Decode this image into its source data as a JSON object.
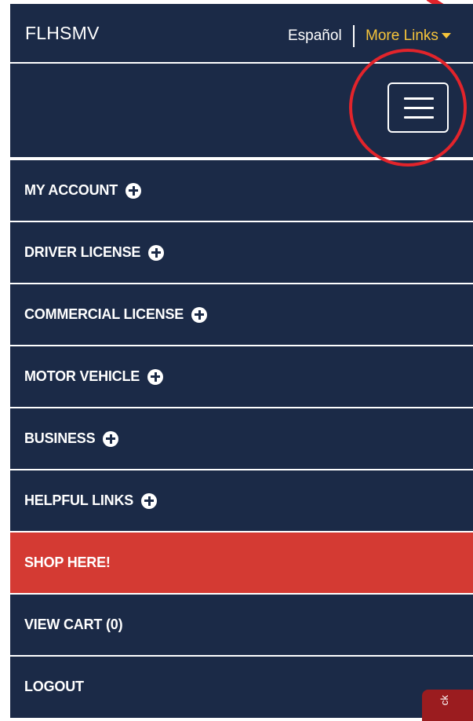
{
  "header": {
    "brand": "FLHSMV",
    "language_link": "Español",
    "more_links": "More Links"
  },
  "menu": {
    "items": [
      {
        "label": "MY ACCOUNT"
      },
      {
        "label": "DRIVER LICENSE"
      },
      {
        "label": "COMMERCIAL LICENSE"
      },
      {
        "label": "MOTOR VEHICLE"
      },
      {
        "label": "BUSINESS"
      },
      {
        "label": "HELPFUL LINKS"
      },
      {
        "label": "SHOP HERE!"
      },
      {
        "label": "VIEW CART (0)"
      },
      {
        "label": "LOGOUT"
      }
    ]
  },
  "feedback_tab": {
    "label": "ck"
  },
  "icons": {
    "menu": "hamburger-menu-icon",
    "expand": "plus-circle-icon",
    "dropdown": "caret-down-icon"
  },
  "colors": {
    "nav_background": "#1b2a47",
    "accent_yellow": "#f6c43a",
    "shop_highlight": "#d43a33",
    "annotation_red": "#e2242b",
    "feedback_tab": "#9b1c1f"
  }
}
